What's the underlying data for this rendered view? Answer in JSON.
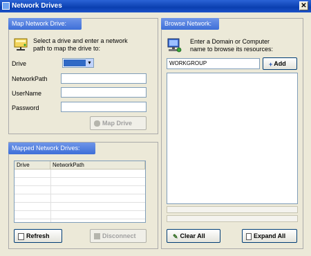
{
  "window": {
    "title": "Network Drives",
    "close_glyph": "✕"
  },
  "map_panel": {
    "title": "Map Network Drive:",
    "instruction_line1": "Select a drive and enter a network",
    "instruction_line2": "path to map the drive to:",
    "drive_label": "Drive",
    "drive_value": "",
    "network_path_label": "NetworkPath",
    "network_path_value": "",
    "username_label": "UserName",
    "username_value": "",
    "password_label": "Password",
    "password_value": "",
    "map_button_label": "Map Drive",
    "dropdown_arrow": "▾",
    "icon": "network-drive-icon"
  },
  "mapped_panel": {
    "title": "Mapped Network Drives:",
    "columns": [
      "Drive",
      "NetworkPath"
    ],
    "refresh_label": "Refresh",
    "disconnect_label": "Disconnect"
  },
  "browse_panel": {
    "title": "Browse Network:",
    "instruction_line1": "Enter a Domain or Computer",
    "instruction_line2": "name to browse its resources:",
    "domain_value": "WORKGROUP",
    "add_label": "Add",
    "clear_all_label": "Clear All",
    "expand_all_label": "Expand All",
    "icon": "computer-network-icon"
  }
}
